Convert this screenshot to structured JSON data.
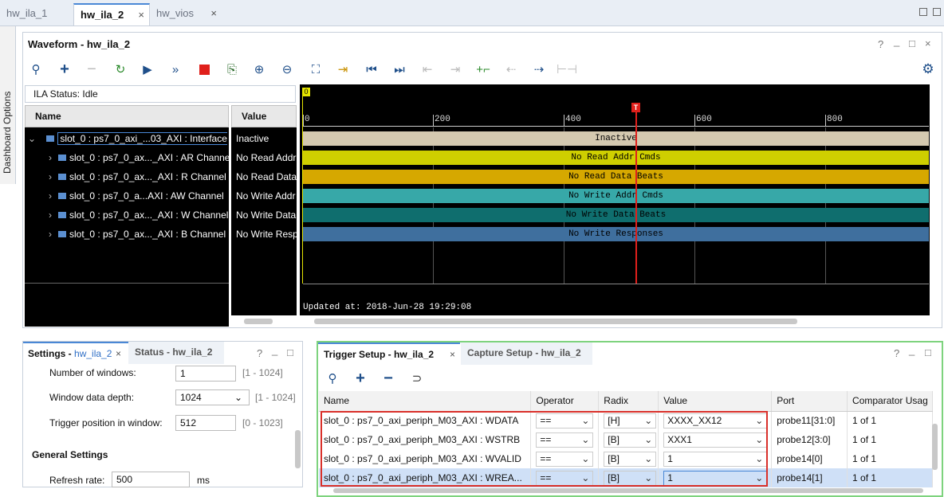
{
  "tabs": [
    {
      "label": "hw_ila_1"
    },
    {
      "label": "hw_ila_2",
      "close": "×"
    },
    {
      "label": "hw_vios",
      "close": "×"
    }
  ],
  "sidebar": {
    "label": "Dashboard Options"
  },
  "waveform": {
    "title": "Waveform - hw_ila_2",
    "ila_status": "ILA Status:  Idle",
    "col_name": "Name",
    "col_value": "Value",
    "rows": [
      {
        "name": "slot_0 : ps7_0_axi_...03_AXI : Interface",
        "value": "Inactive"
      },
      {
        "name": "slot_0 : ps7_0_ax..._AXI : AR Channel",
        "value": "No Read Addr"
      },
      {
        "name": "slot_0 : ps7_0_ax..._AXI : R Channel",
        "value": "No Read Data"
      },
      {
        "name": "slot_0 : ps7_0_a...AXI : AW Channel",
        "value": "No Write Addr"
      },
      {
        "name": "slot_0 : ps7_0_ax..._AXI : W Channel",
        "value": "No Write Data"
      },
      {
        "name": "slot_0 : ps7_0_ax..._AXI : B Channel",
        "value": "No Write Resp"
      }
    ],
    "ticks": [
      "0",
      "200",
      "400",
      "600",
      "800"
    ],
    "marker_top": "0",
    "trigger_marker": "T",
    "bars": [
      {
        "label": "Inactive",
        "color": "#d4c9b0"
      },
      {
        "label": "No Read Addr Cmds",
        "color": "#cfcf00"
      },
      {
        "label": "No Read Data Beats",
        "color": "#d6a800"
      },
      {
        "label": "No Write Addr Cmds",
        "color": "#37a8a8"
      },
      {
        "label": "No Write Data Beats",
        "color": "#0f6e6e"
      },
      {
        "label": "No Write Responses",
        "color": "#3f6f9e"
      }
    ],
    "updated": "Updated at: 2018-Jun-28 19:29:08"
  },
  "settings": {
    "tab_active": "Settings - ",
    "tab_active_link": "hw_ila_2",
    "tab_other": "Status - hw_ila_2",
    "fields": [
      {
        "label": "Number of windows:",
        "value": "1",
        "range": "[1 - 1024]"
      },
      {
        "label": "Window data depth:",
        "value": "1024",
        "range": "[1 - 1024]"
      },
      {
        "label": "Trigger position in window:",
        "value": "512",
        "range": "[0 - 1023]"
      }
    ],
    "section": "General Settings",
    "refresh_label": "Refresh rate:",
    "refresh_value": "500",
    "refresh_unit": "ms"
  },
  "trigger": {
    "tab_active": "Trigger Setup - hw_ila_2",
    "tab_other": "Capture Setup - hw_ila_2",
    "headers": [
      "Name",
      "Operator",
      "Radix",
      "Value",
      "Port",
      "Comparator Usag"
    ],
    "rows": [
      {
        "name": "slot_0 : ps7_0_axi_periph_M03_AXI : WDATA",
        "op": "==",
        "radix": "[H]",
        "value": "XXXX_XX12",
        "port": "probe11[31:0]",
        "usage": "1 of 1"
      },
      {
        "name": "slot_0 : ps7_0_axi_periph_M03_AXI : WSTRB",
        "op": "==",
        "radix": "[B]",
        "value": "XXX1",
        "port": "probe12[3:0]",
        "usage": "1 of 1"
      },
      {
        "name": "slot_0 : ps7_0_axi_periph_M03_AXI : WVALID",
        "op": "==",
        "radix": "[B]",
        "value": "1",
        "port": "probe14[0]",
        "usage": "1 of 1"
      },
      {
        "name": "slot_0 : ps7_0_axi_periph_M03_AXI : WREA...",
        "op": "==",
        "radix": "[B]",
        "value": "1",
        "port": "probe14[1]",
        "usage": "1 of 1"
      }
    ]
  },
  "window_controls": {
    "help": "?",
    "min": "_",
    "max": "□"
  }
}
